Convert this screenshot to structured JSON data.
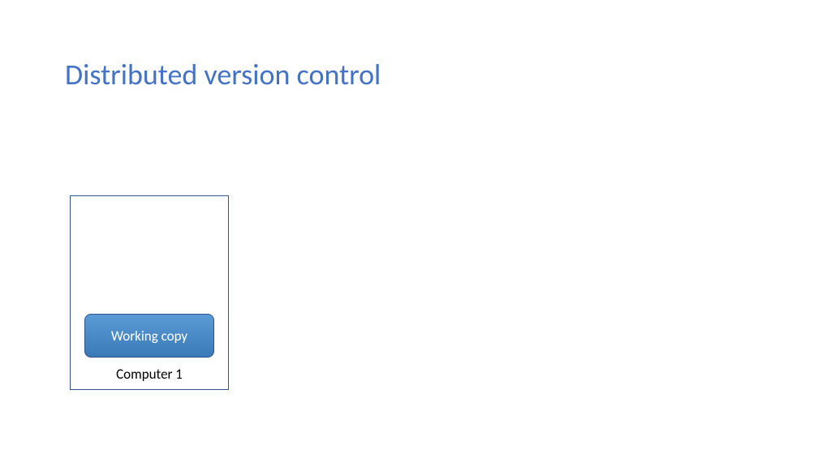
{
  "title": "Distributed version control",
  "diagram": {
    "computer": {
      "label": "Computer 1",
      "working_copy_label": "Working copy"
    }
  }
}
